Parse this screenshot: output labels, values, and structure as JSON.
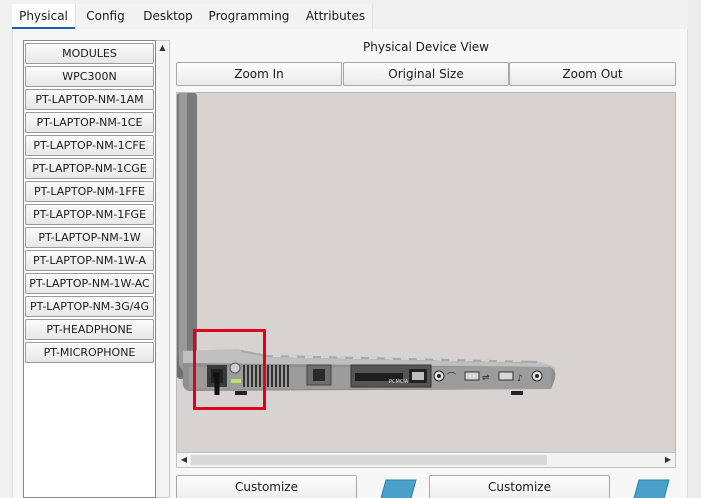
{
  "tabs": [
    {
      "label": "Physical",
      "active": true
    },
    {
      "label": "Config",
      "active": false
    },
    {
      "label": "Desktop",
      "active": false
    },
    {
      "label": "Programming",
      "active": false
    },
    {
      "label": "Attributes",
      "active": false
    }
  ],
  "modules": {
    "items": [
      "MODULES",
      "WPC300N",
      "PT-LAPTOP-NM-1AM",
      "PT-LAPTOP-NM-1CE",
      "PT-LAPTOP-NM-1CFE",
      "PT-LAPTOP-NM-1CGE",
      "PT-LAPTOP-NM-1FFE",
      "PT-LAPTOP-NM-1FGE",
      "PT-LAPTOP-NM-1W",
      "PT-LAPTOP-NM-1W-A",
      "PT-LAPTOP-NM-1W-AC",
      "PT-LAPTOP-NM-3G/4G",
      "PT-HEADPHONE",
      "PT-MICROPHONE"
    ]
  },
  "device_view": {
    "title": "Physical Device View",
    "zoom_in": "Zoom In",
    "original_size": "Original Size",
    "zoom_out": "Zoom Out",
    "port_label": "PCMCIA",
    "highlight_color": "#e0001b"
  },
  "customize": [
    {
      "label": "Customize"
    },
    {
      "label": "Customize"
    }
  ]
}
